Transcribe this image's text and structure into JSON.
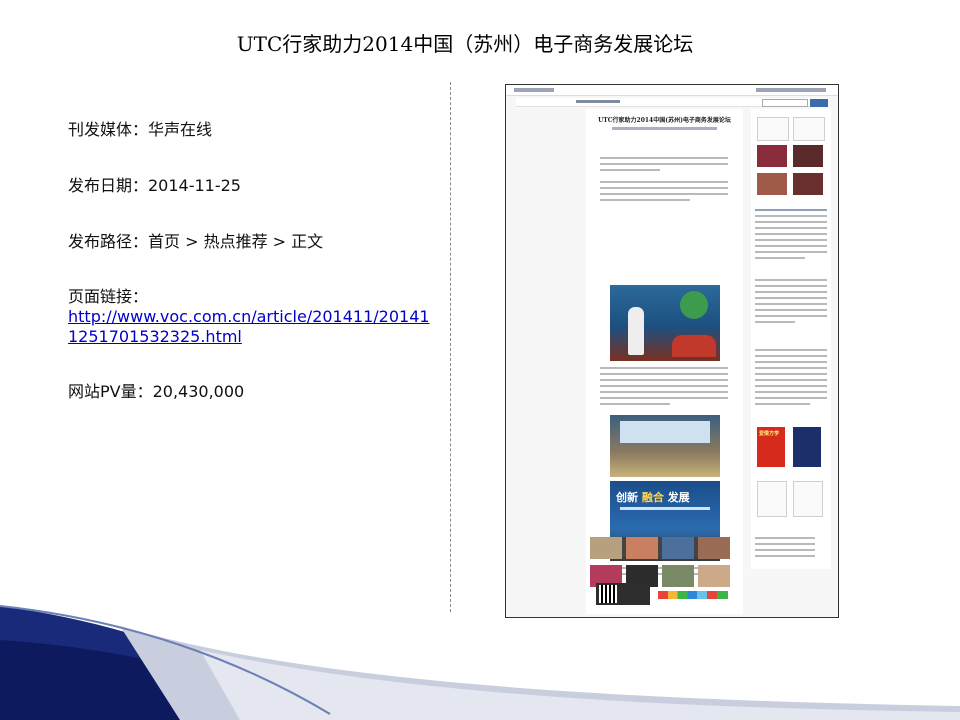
{
  "slide": {
    "title": "UTC行家助力2014中国（苏州）电子商务发展论坛",
    "media": "刊发媒体：华声在线",
    "date": "发布日期：2014-11-25",
    "path": "发布路径：首页 > 热点推荐 > 正文",
    "link_label": "页面链接：",
    "link_url": "http://www.voc.com.cn/article/201411/201411251701532325.html",
    "pv": "网站PV量：20,430,000"
  },
  "screenshot": {
    "article_title": "UTC行家助力2014中国(苏州)电子商务发展论坛",
    "banner_text_a": "创新",
    "banner_text_b": " 融合 ",
    "banner_text_c": "发展",
    "book1_title": "爱情方学",
    "colors": {
      "link": "#0000cc",
      "photo_blue": "#1d4f80",
      "book_red": "#d62a1d",
      "book_navy": "#1d2f6b"
    }
  }
}
